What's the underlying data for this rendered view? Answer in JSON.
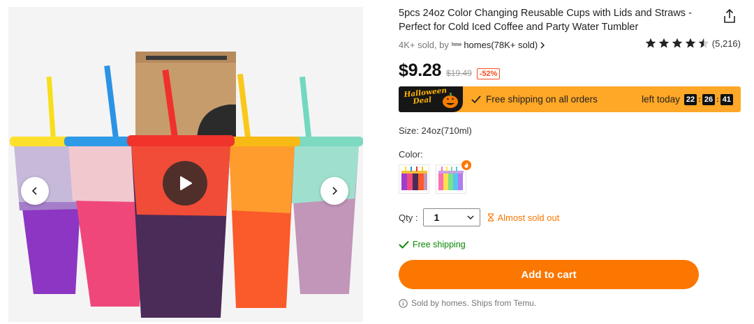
{
  "product": {
    "title": "5pcs 24oz Color Changing Reusable Cups with Lids and Straws - Perfect for Cold Iced Coffee and Party Water Tumbler",
    "sold_prefix": "4K+ sold, by",
    "store_logo_text": "hme",
    "store_name": "homes(78K+ sold)",
    "rating_value": 4.5,
    "rating_count": "(5,216)",
    "price": "$9.28",
    "original_price": "$19.49",
    "discount": "-52%"
  },
  "promo": {
    "badge_line1": "Halloween",
    "badge_line2": "Deal",
    "text": "Free shipping on all orders",
    "timer_label": "left today",
    "timer": [
      "22",
      "26",
      "41"
    ]
  },
  "options": {
    "size_text": "Size: 24oz(710ml)",
    "color_label": "Color:",
    "qty_label": "Qty :",
    "qty_value": "1",
    "stock_text": "Almost sold out"
  },
  "shipping_text": "Free shipping",
  "add_to_cart_label": "Add to cart",
  "sold_by_text": "Sold by homes. Ships from Temu.",
  "icons": {
    "share": "share-icon",
    "prev": "chevron-left-icon",
    "next": "chevron-right-icon",
    "play": "play-icon",
    "check": "check-icon",
    "hourglass": "hourglass-icon",
    "info": "info-icon"
  },
  "colors": {
    "accent_orange": "#fb7701",
    "promo_bar": "#ffa727",
    "discount_red": "#fb4b1e",
    "ship_green": "#0a8800"
  }
}
